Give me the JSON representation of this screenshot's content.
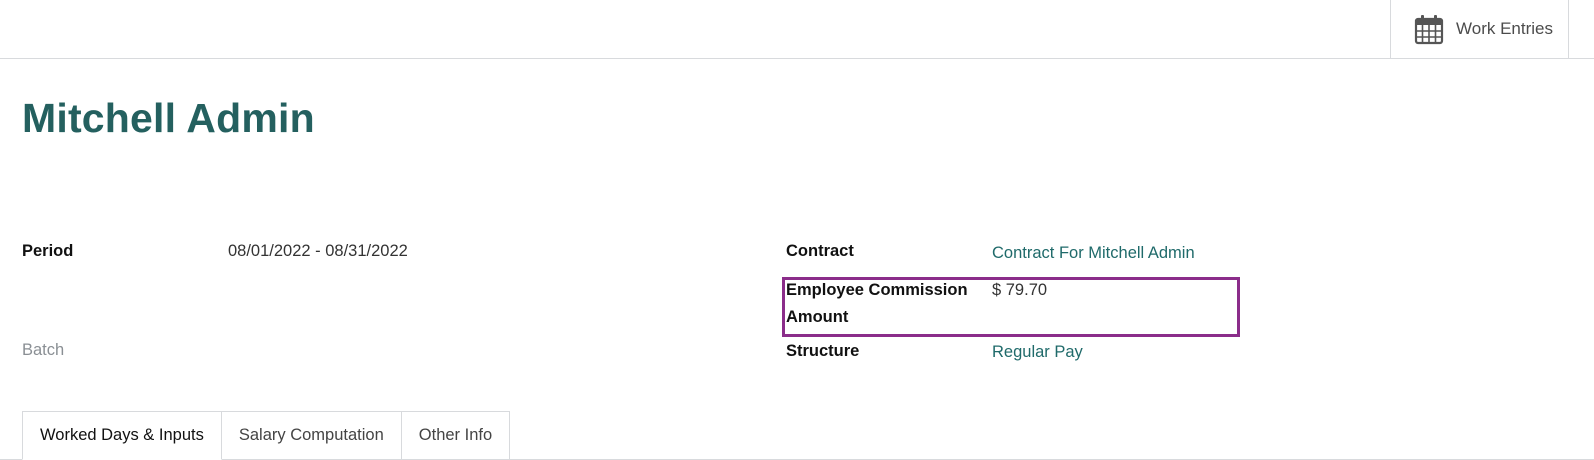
{
  "header": {
    "smart_button": {
      "label": "Work Entries",
      "icon": "calendar-icon"
    }
  },
  "record": {
    "title": "Mitchell Admin"
  },
  "fields": {
    "period": {
      "label": "Period",
      "value": "08/01/2022 - 08/31/2022"
    },
    "batch": {
      "label": "Batch",
      "value": ""
    },
    "contract": {
      "label": "Contract",
      "value": "Contract For Mitchell Admin"
    },
    "commission": {
      "label_line1": "Employee Commission",
      "label_line2": "Amount",
      "value": "$ 79.70"
    },
    "structure": {
      "label": "Structure",
      "value": "Regular Pay"
    }
  },
  "tabs": [
    {
      "label": "Worked Days & Inputs",
      "active": true
    },
    {
      "label": "Salary Computation",
      "active": false
    },
    {
      "label": "Other Info",
      "active": false
    }
  ],
  "colors": {
    "title": "#24605f",
    "link": "#1f6a6a",
    "highlight": "#8b2d8a",
    "border": "#d8dadd"
  }
}
